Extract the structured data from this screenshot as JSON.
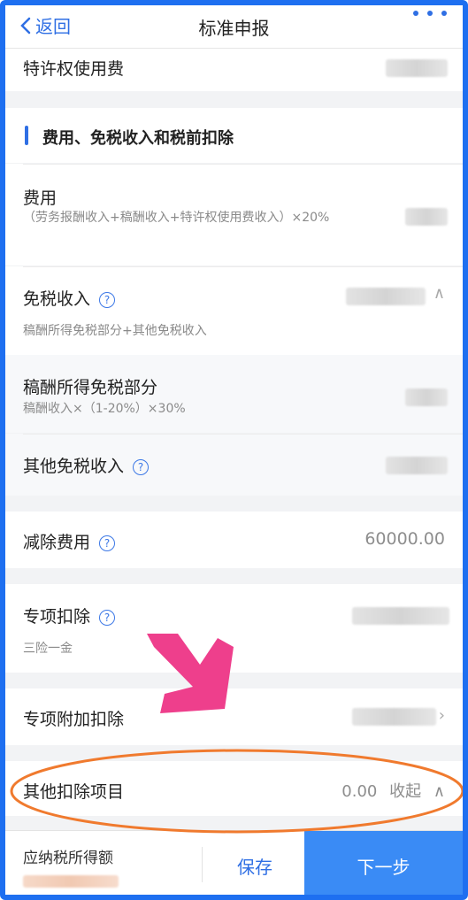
{
  "nav": {
    "back_label": "返回",
    "title": "标准申报"
  },
  "rows": {
    "franchise_fee": "特许权使用费",
    "section_title": "费用、免税收入和税前扣除",
    "expense_label": "费用",
    "expense_formula": "（劳务报酬收入+稿酬收入+特许权使用费收入）×20%",
    "tax_free_income_label": "免税收入",
    "tax_free_income_desc": "稿酬所得免税部分+其他免税收入",
    "royalty_exempt_label": "稿酬所得免税部分",
    "royalty_exempt_formula": "稿酬收入×（1-20%）×30%",
    "other_tax_free_label": "其他免税收入",
    "deduction_fee_label": "减除费用",
    "deduction_fee_value": "60000.00",
    "special_deduction_label": "专项扣除",
    "special_deduction_desc": "三险一金",
    "additional_deduction_label": "专项附加扣除",
    "other_deduction_label": "其他扣除项目",
    "other_deduction_value": "0.00",
    "collapse_label": "收起"
  },
  "bottom": {
    "taxable_income_label": "应纳税所得额",
    "save_label": "保存",
    "next_label": "下一步"
  },
  "colors": {
    "accent": "#2f6fe4",
    "next_button": "#3a8bf5",
    "annotation_arrow": "#ee3f8c",
    "annotation_ellipse": "#f07a2e",
    "frame_border": "#1e6ff0"
  },
  "icons": [
    "back-chevron-icon",
    "more-dots-icon",
    "help-icon",
    "chevron-up-icon",
    "chevron-right-icon"
  ]
}
